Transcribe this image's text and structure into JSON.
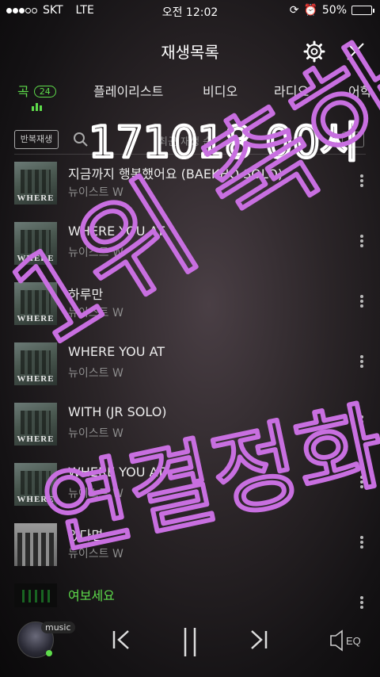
{
  "status": {
    "carrier": "SKT",
    "network": "LTE",
    "time": "오전 12:02",
    "battery": "50%",
    "battery_level": 0.5
  },
  "header": {
    "title": "재생목록",
    "settings_icon": "gear-icon",
    "close_icon": "close-icon"
  },
  "tabs": [
    {
      "label": "곡",
      "count": "24",
      "active": true
    },
    {
      "label": "플레이리스트"
    },
    {
      "label": "비디오"
    },
    {
      "label": "라디오"
    },
    {
      "label": "어학"
    }
  ],
  "toolbar": {
    "repeat_label": "반복재생",
    "search_hint": "최근 재생 순"
  },
  "songs": [
    {
      "title": "지금까지 행복했어요 (BAEKHO SOLO)",
      "artist": "뉴이스트 W",
      "art": "album"
    },
    {
      "title": "WHERE YOU AT",
      "artist": "뉴이스트 W",
      "art": "album"
    },
    {
      "title": "하루만",
      "artist": "뉴이스트 W",
      "art": "album"
    },
    {
      "title": "WHERE YOU AT",
      "artist": "뉴이스트 W",
      "art": "album"
    },
    {
      "title": "WITH (JR SOLO)",
      "artist": "뉴이스트 W",
      "art": "album"
    },
    {
      "title": "WHERE YOU AT",
      "artist": "뉴이스트 W",
      "art": "album"
    },
    {
      "title": "있다면",
      "artist": "뉴이스트 W",
      "art": "photo"
    },
    {
      "title": "여보세요",
      "artist": "",
      "art": "dark",
      "playing": true
    }
  ],
  "player": {
    "music_label": "music",
    "eq_label": "EQ"
  },
  "handwriting": {
    "line1": "171018 00시",
    "line2": "1위 축하",
    "line3": "연결정화"
  },
  "colors": {
    "accent": "#5edc4b",
    "handwriting": "#c86fe0"
  }
}
